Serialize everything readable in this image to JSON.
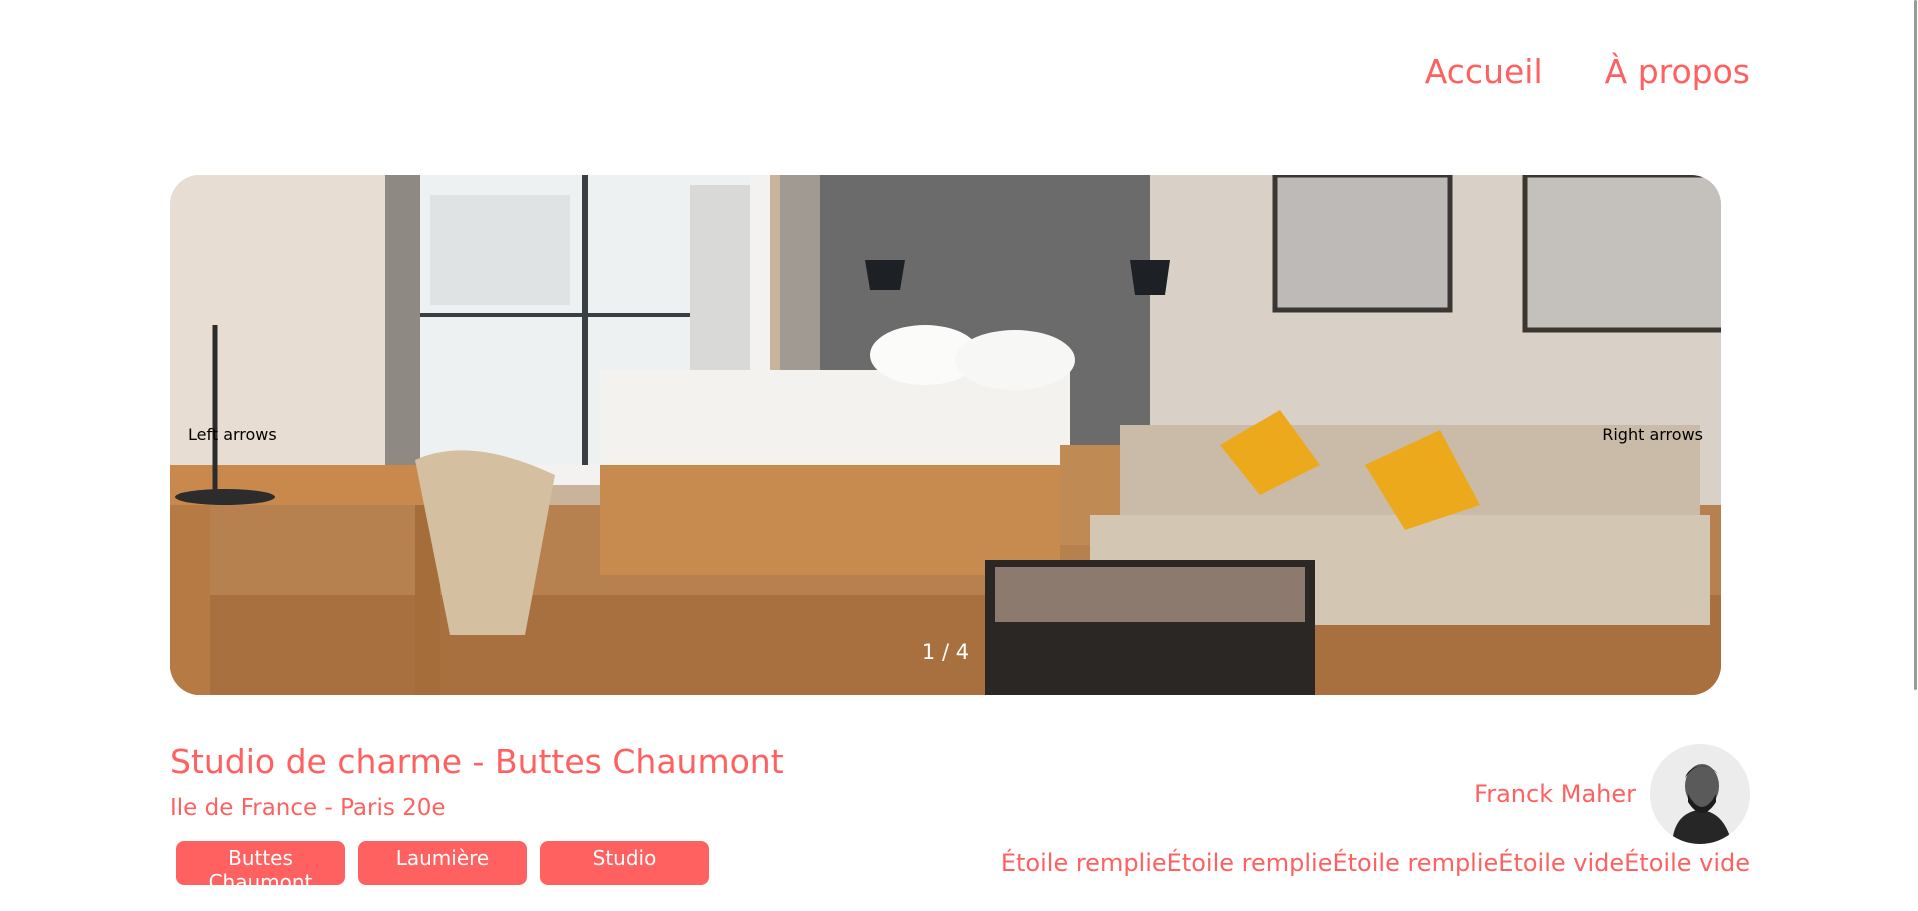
{
  "nav": {
    "home": "Accueil",
    "about": "À propos"
  },
  "carousel": {
    "left_arrow": "Left arrows",
    "right_arrow": "Right arrows",
    "counter": "1 / 4"
  },
  "listing": {
    "title": "Studio de charme - Buttes Chaumont",
    "location": "Ile de France - Paris 20e",
    "tags": [
      "Buttes Chaumont",
      "Laumière",
      "Studio"
    ]
  },
  "host": {
    "name": "Franck Maher"
  },
  "rating": {
    "stars": [
      "Étoile remplie",
      "Étoile remplie",
      "Étoile remplie",
      "Étoile vide",
      "Étoile vide"
    ],
    "value": 3,
    "max": 5
  },
  "colors": {
    "accent": "#ff6060",
    "background": "#ffffff"
  },
  "icons": {
    "avatar": "host-portrait"
  }
}
